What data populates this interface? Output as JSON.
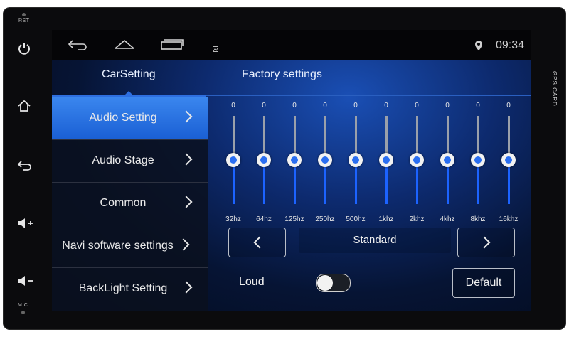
{
  "hardware": {
    "rst_label": "RST",
    "mic_label": "MIC",
    "gps_card_label": "GPS CARD",
    "icons": [
      "power-icon",
      "home-icon",
      "back-icon",
      "volume-up-icon",
      "volume-down-icon"
    ]
  },
  "statusbar": {
    "time": "09:34",
    "icons": [
      "back-icon",
      "home-icon",
      "recent-apps-icon",
      "image-icon",
      "location-icon"
    ]
  },
  "tabs": [
    {
      "label": "CarSetting",
      "active": true
    },
    {
      "label": "Factory settings",
      "active": false
    }
  ],
  "menu": [
    {
      "label": "Audio Setting",
      "active": true
    },
    {
      "label": "Audio Stage",
      "active": false
    },
    {
      "label": "Common",
      "active": false
    },
    {
      "label": "Navi software settings",
      "active": false
    },
    {
      "label": "BackLight Setting",
      "active": false
    }
  ],
  "equalizer": {
    "bands": [
      {
        "freq": "32hz",
        "value": "0",
        "level": 0.5
      },
      {
        "freq": "64hz",
        "value": "0",
        "level": 0.5
      },
      {
        "freq": "125hz",
        "value": "0",
        "level": 0.5
      },
      {
        "freq": "250hz",
        "value": "0",
        "level": 0.5
      },
      {
        "freq": "500hz",
        "value": "0",
        "level": 0.5
      },
      {
        "freq": "1khz",
        "value": "0",
        "level": 0.5
      },
      {
        "freq": "2khz",
        "value": "0",
        "level": 0.5
      },
      {
        "freq": "4khz",
        "value": "0",
        "level": 0.5
      },
      {
        "freq": "8khz",
        "value": "0",
        "level": 0.5
      },
      {
        "freq": "16khz",
        "value": "0",
        "level": 0.5
      }
    ],
    "preset": "Standard"
  },
  "loud": {
    "label": "Loud",
    "on": false
  },
  "default_label": "Default",
  "colors": {
    "accent": "#1c63ff",
    "active_menu": "#2f76e6"
  }
}
